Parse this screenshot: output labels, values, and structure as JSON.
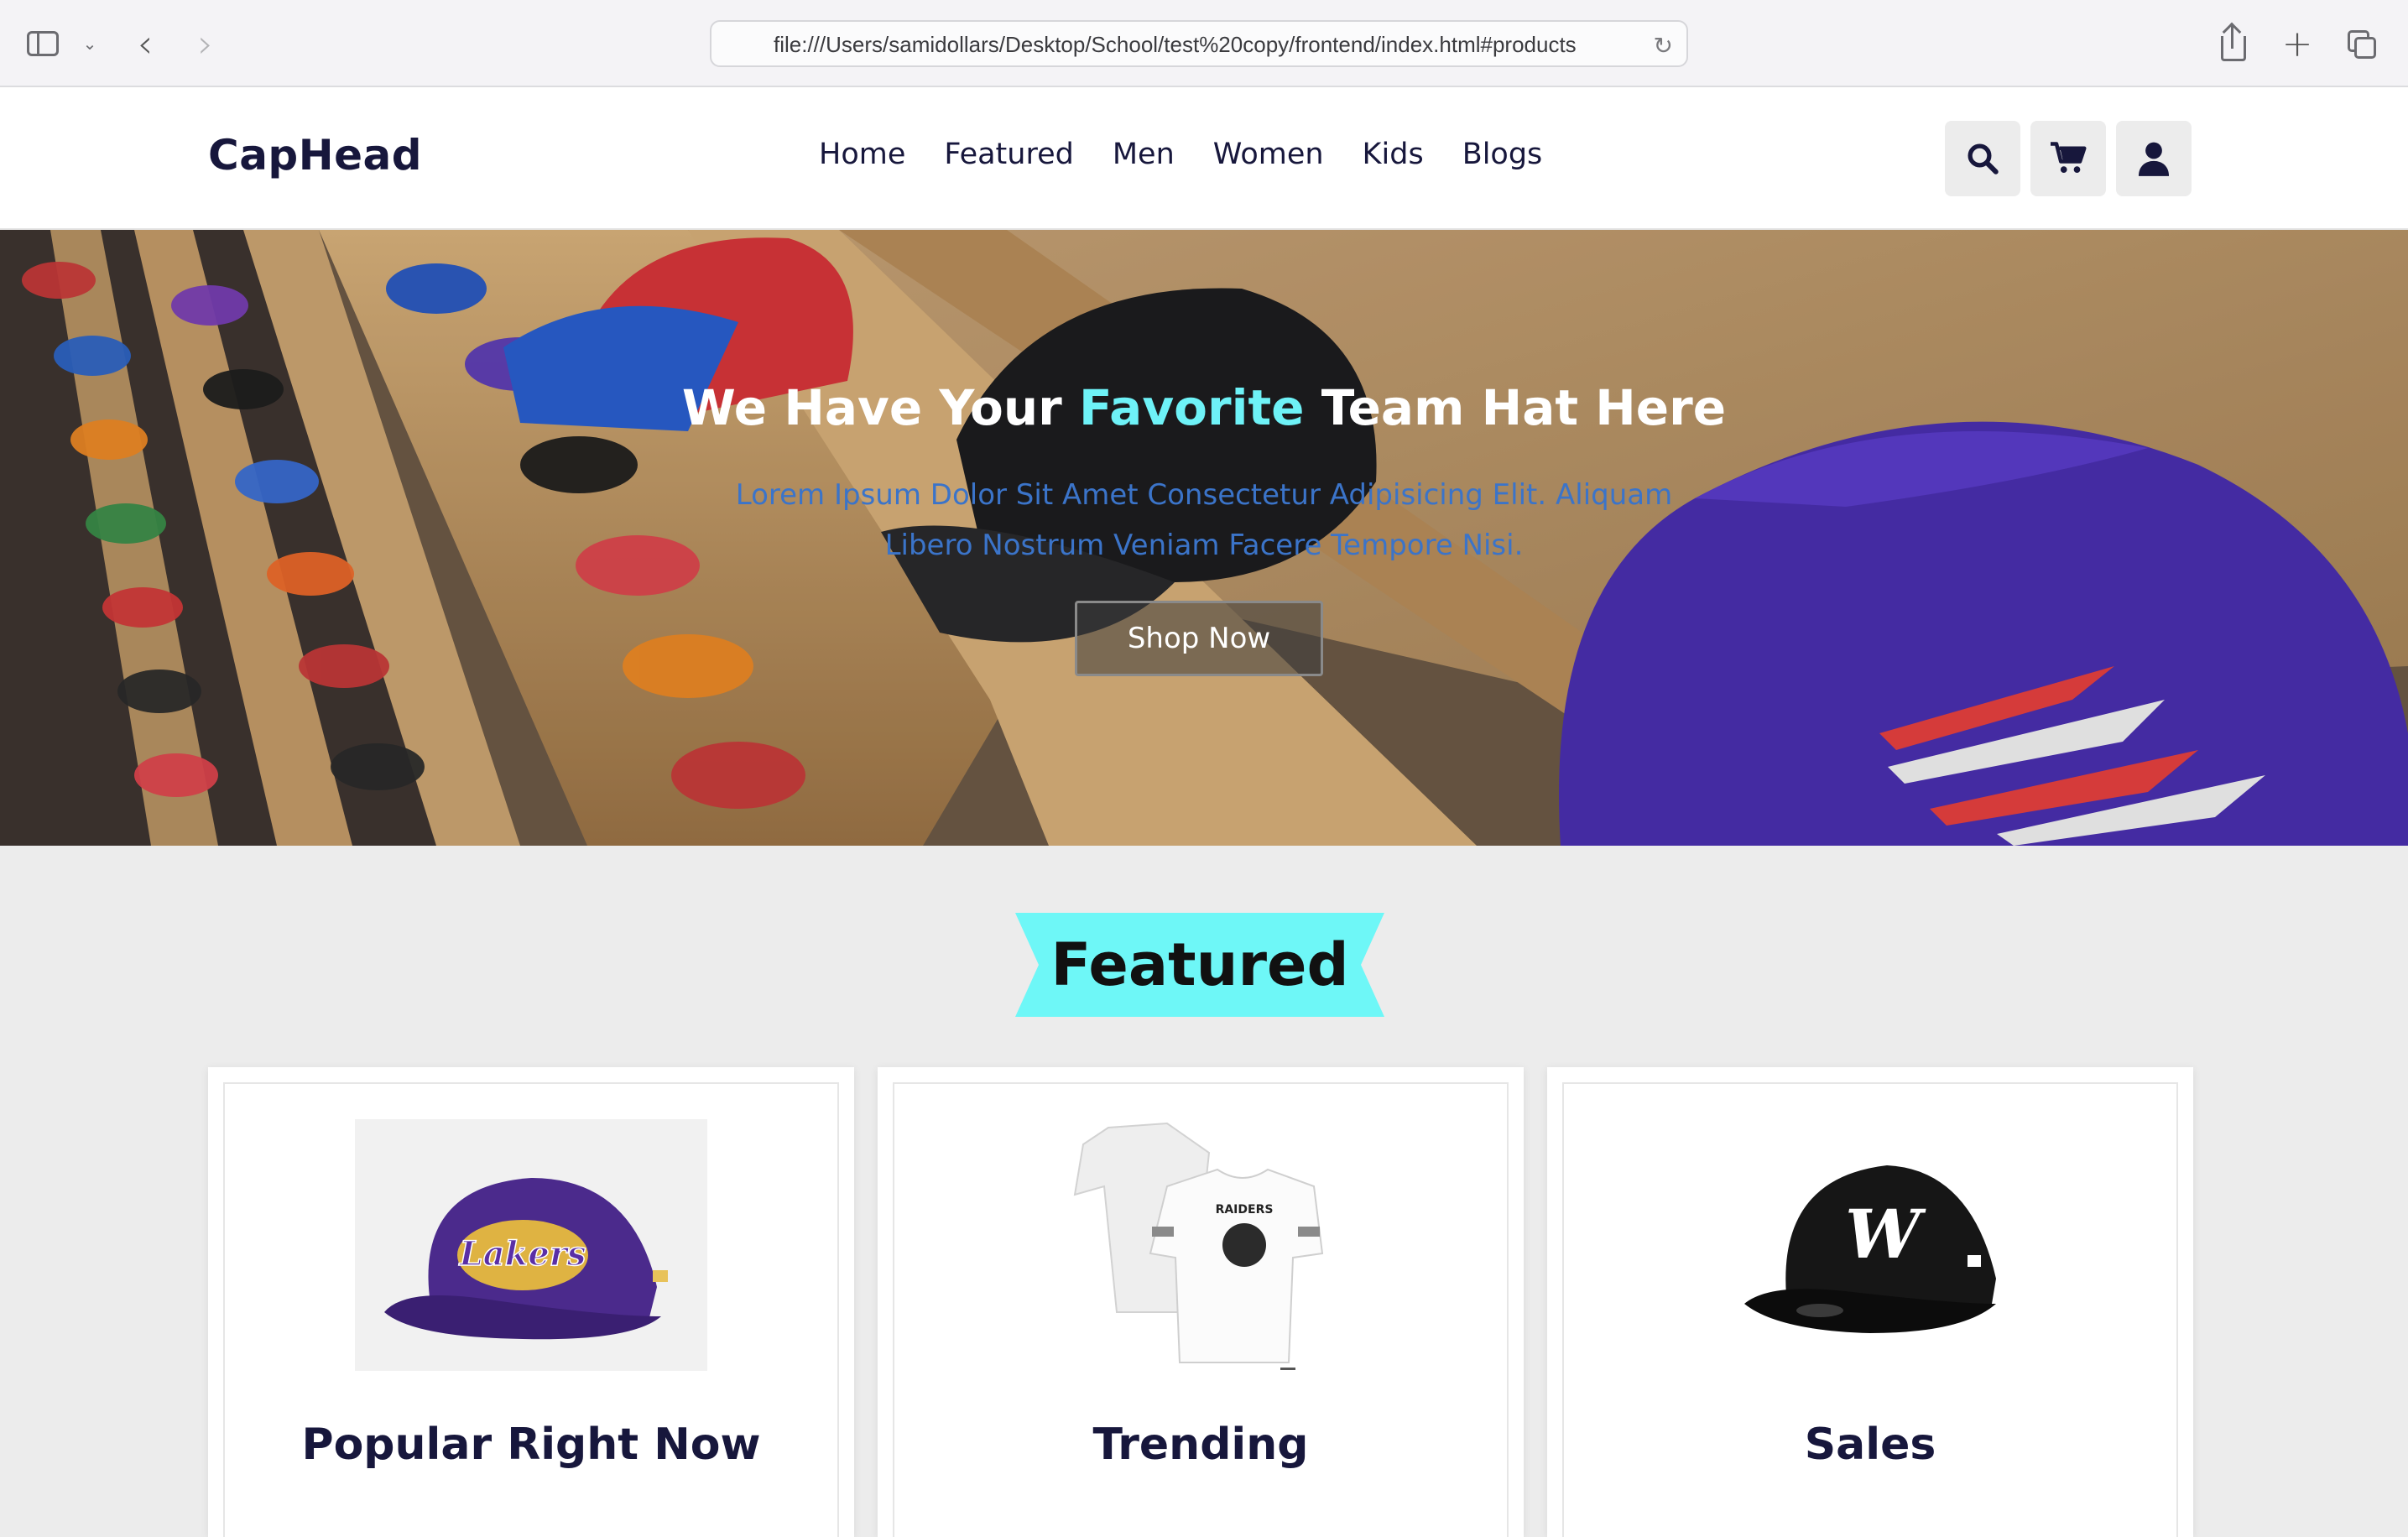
{
  "browser": {
    "url": "file:///Users/samidollars/Desktop/School/test%20copy/frontend/index.html#products"
  },
  "header": {
    "logo": "CapHead",
    "nav": [
      "Home",
      "Featured",
      "Men",
      "Women",
      "Kids",
      "Blogs"
    ],
    "icons": [
      "search-icon",
      "cart-icon",
      "user-icon"
    ]
  },
  "hero": {
    "title_part1": "We Have Your ",
    "title_accent": "Favorite",
    "title_part2": " Team Hat Here",
    "subtitle": "Lorem Ipsum Dolor Sit Amet Consectetur Adipisicing Elit. Aliquam Libero Nostrum Veniam Facere Tempore Nisi.",
    "button": "Shop Now"
  },
  "featured": {
    "heading": "Featured",
    "cards": [
      {
        "title": "Popular Right Now",
        "image": "purple-lakers-cap"
      },
      {
        "title": "Trending",
        "image": "white-raiders-jersey"
      },
      {
        "title": "Sales",
        "image": "black-nationals-cap"
      }
    ]
  },
  "colors": {
    "brand_dark": "#17173c",
    "accent_cyan": "#6ef2f7",
    "subtitle_blue": "#3b74c9",
    "page_bg": "#ececec"
  }
}
